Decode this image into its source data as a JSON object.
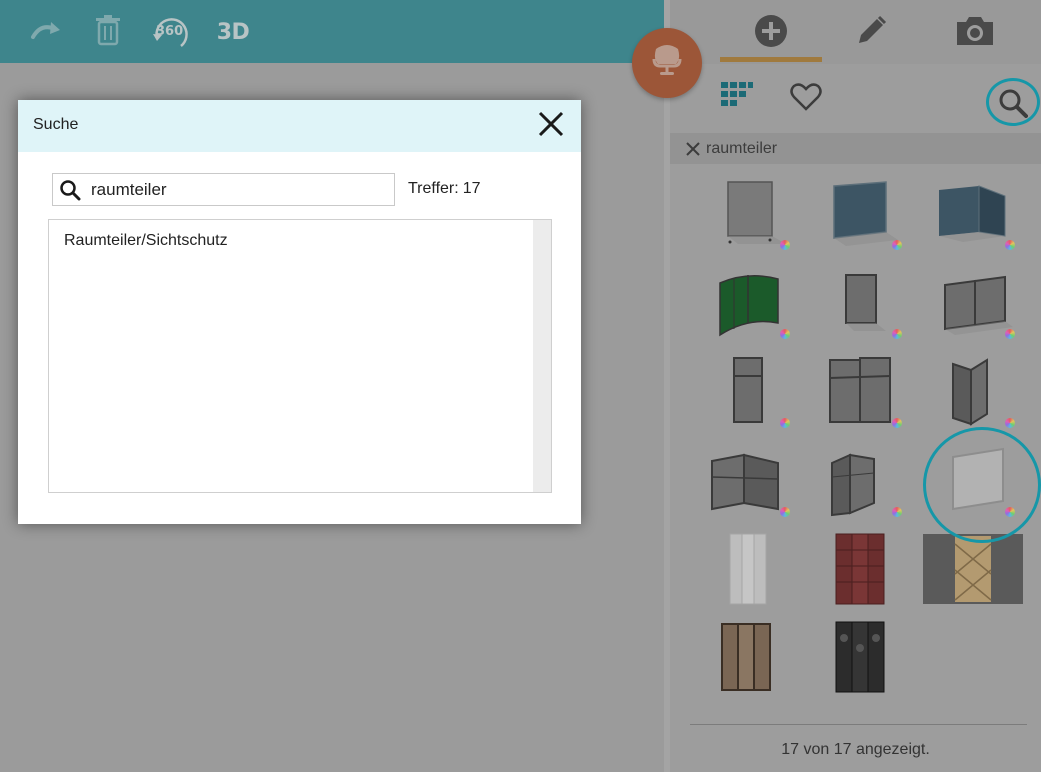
{
  "toolbar": {
    "buttons": [
      {
        "name": "redo",
        "icon": "redo-icon"
      },
      {
        "name": "delete",
        "icon": "trash-icon"
      },
      {
        "name": "rotate-360",
        "icon": "rotate-360-icon",
        "label": "360"
      },
      {
        "name": "view-3d",
        "label": "3D"
      }
    ],
    "color": "#3e858c"
  },
  "fab": {
    "icon": "chair-icon",
    "color": "#9c5638"
  },
  "sidebar": {
    "tabs": [
      {
        "name": "add",
        "icon": "plus-circle-icon",
        "active": true
      },
      {
        "name": "edit",
        "icon": "pencil-icon"
      },
      {
        "name": "photo",
        "icon": "camera-icon"
      }
    ],
    "subbar": {
      "icons": [
        "grid-view-icon",
        "heart-icon",
        "search-icon"
      ]
    },
    "filter": {
      "label": "raumteiler",
      "clear_icon": "close-icon"
    },
    "products": [
      {
        "name": "grey-panel-screen"
      },
      {
        "name": "blue-panel-screen"
      },
      {
        "name": "blue-corner-screen"
      },
      {
        "name": "green-curved-screen"
      },
      {
        "name": "single-frame-screen"
      },
      {
        "name": "double-frame-screen"
      },
      {
        "name": "tall-single-screen"
      },
      {
        "name": "tall-double-screen"
      },
      {
        "name": "tall-angled-screen"
      },
      {
        "name": "corner-frame-screen"
      },
      {
        "name": "folding-frame-screen"
      },
      {
        "name": "glass-screen",
        "highlighted": true
      },
      {
        "name": "white-folding-screen"
      },
      {
        "name": "red-lattice-screen"
      },
      {
        "name": "wood-lattice-screen-photo"
      },
      {
        "name": "wood-folding-screen"
      },
      {
        "name": "black-ornament-screen"
      }
    ],
    "count_text": "17 von 17 angezeigt."
  },
  "dialog": {
    "title": "Suche",
    "search_value": "raumteiler",
    "hits_label": "Treffer:",
    "hits_count": "17",
    "results": [
      "Raumteiler/Sichtschutz"
    ]
  },
  "colors": {
    "highlight_ring": "#1697a8",
    "dialog_header_bg": "#dff4f8",
    "active_tab_underline": "#a07a3e"
  }
}
